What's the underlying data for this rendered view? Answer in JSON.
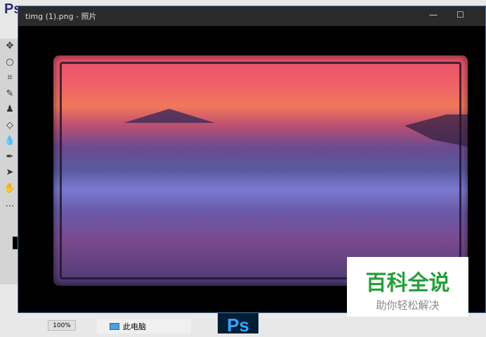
{
  "photoshop": {
    "logo": "Ps",
    "zoom": "100%",
    "tools": [
      "move-icon",
      "lasso-icon",
      "crop-icon",
      "healing-icon",
      "stamp-icon",
      "eraser-icon",
      "blur-icon",
      "pen-icon",
      "select-icon",
      "hand-icon",
      "more-icon"
    ]
  },
  "viewer": {
    "title": "timg (1).png - 照片",
    "minimize": "—",
    "maximize": "☐",
    "close": "✕"
  },
  "watermark": {
    "line1": "百科全说",
    "line2": "助你轻松解决"
  },
  "explorer": {
    "this_pc": "此电脑"
  },
  "taskbar": {
    "ps_icon": "Ps"
  }
}
